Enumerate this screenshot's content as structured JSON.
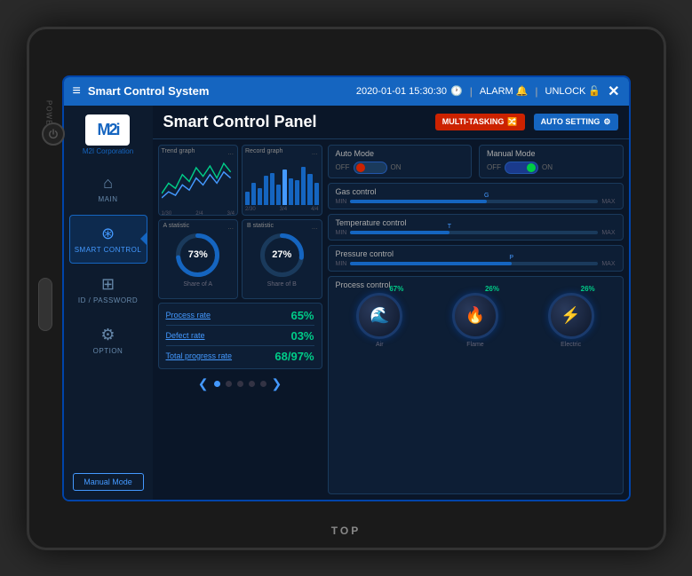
{
  "device": {
    "brand": "TOP",
    "power_label": "POWER"
  },
  "topbar": {
    "menu_label": "≡",
    "title": "Smart Control System",
    "datetime": "2020-01-01  15:30:30",
    "clock_icon": "🕐",
    "alarm_label": "ALARM",
    "alarm_icon": "🔔",
    "unlock_label": "UNLOCK",
    "lock_icon": "🔓",
    "close_label": "✕"
  },
  "sidebar": {
    "logo": "M2i",
    "corp_name": "M2I Corporation",
    "nav_items": [
      {
        "id": "main",
        "label": "MAIN",
        "icon": "⌂",
        "active": false
      },
      {
        "id": "smart_control",
        "label": "SMART CONTROL",
        "icon": "⊛",
        "active": true
      },
      {
        "id": "id_password",
        "label": "ID / PASSWORD",
        "icon": "⊞",
        "active": false
      },
      {
        "id": "option",
        "label": "OPTION",
        "icon": "⚙",
        "active": false
      }
    ],
    "manual_mode_btn": "Manual Mode"
  },
  "content": {
    "title": "Smart Control Panel",
    "btn_multitasking": "MULTI-TASKING",
    "btn_autosetting": "AUTO SETTING",
    "charts": {
      "line_chart_label": "Trend graph",
      "bar_chart_label": "Record graph",
      "line_data": [
        30,
        45,
        38,
        55,
        42,
        60,
        50,
        65,
        48,
        70
      ],
      "bar_data": [
        20,
        35,
        25,
        40,
        45,
        30,
        50,
        42,
        38,
        55,
        48,
        35,
        60,
        52,
        45,
        58
      ],
      "bar_highlight_index": 10,
      "x_labels": [
        "1/30",
        "2/4",
        "3/45",
        "3/4"
      ]
    },
    "statistics": {
      "a_stat_label": "A statistic",
      "b_stat_label": "B statistic",
      "a_value": 73,
      "b_value": 27,
      "a_sub": "Share of A",
      "b_sub": "Share of B",
      "a_color": "#1565c0",
      "b_color": "#1565c0"
    },
    "metrics": [
      {
        "name": "Process rate",
        "value": "65%"
      },
      {
        "name": "Defect rate",
        "value": "03%"
      },
      {
        "name": "Total progress rate",
        "value": "68/97%"
      }
    ],
    "pagination": {
      "prev": "❮",
      "next": "❯",
      "dots": [
        true,
        false,
        false,
        false,
        false
      ],
      "total_dots": 5
    },
    "auto_mode": {
      "title": "Auto Mode",
      "off_label": "OFF",
      "on_label": "ON",
      "state": "left"
    },
    "manual_mode": {
      "title": "Manual Mode",
      "off_label": "OFF",
      "on_label": "ON",
      "state": "right"
    },
    "gas_control": {
      "title": "Gas control",
      "min_label": "MIN",
      "max_label": "MAX",
      "thumb_label": "G",
      "fill_percent": 55
    },
    "temp_control": {
      "title": "Temperature control",
      "min_label": "MIN",
      "max_label": "MAX",
      "thumb_label": "T",
      "fill_percent": 40
    },
    "pressure_control": {
      "title": "Pressure control",
      "min_label": "MIN",
      "max_label": "MAX",
      "thumb_label": "P",
      "fill_percent": 65
    },
    "process_control": {
      "title": "Process control",
      "knobs": [
        {
          "label": "Air",
          "icon": "🌊",
          "percent": "67%"
        },
        {
          "label": "Flame",
          "icon": "🔥",
          "percent": "26%"
        },
        {
          "label": "Electric",
          "icon": "⚡",
          "percent": "26%"
        }
      ]
    }
  }
}
